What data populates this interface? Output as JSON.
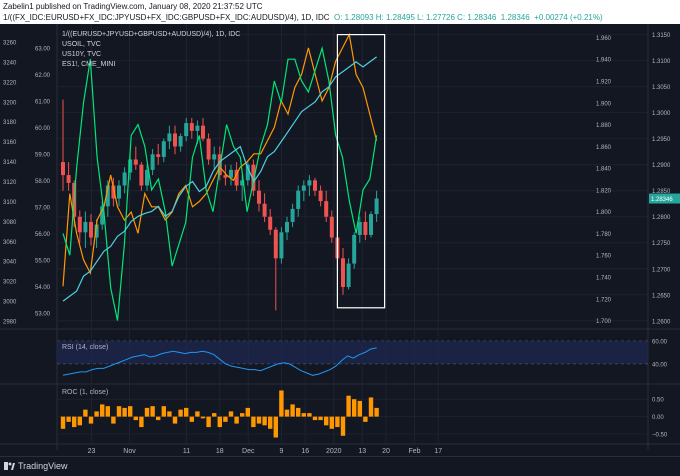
{
  "header": {
    "publisher": "Zabelin1 published on TradingView.com, January 08, 2020 21:37:52 UTC",
    "symbol_line": "1/((FX_IDC:EURUSD+FX_IDC:JPYUSD+FX_IDC:GBPUSD+FX_IDC:AUDUSD)/4), 1D, IDC",
    "ohlc": "O: 1.28093 H: 1.28495 L: 1.27726 C: 1.28346",
    "last": "1.28346",
    "change": "+0.00274 (+0.21%)"
  },
  "legend": {
    "main": "1/((EURUSD+JPYUSD+GBPUSD+AUDUSD)/4), 1D, IDC",
    "s1": "USOIL, TVC",
    "s2": "US10Y, TVC",
    "s3": "ES1!, CME_MINI"
  },
  "footer": {
    "brand": "TradingView"
  },
  "colors": {
    "bg": "#131722",
    "grid": "#1e2230",
    "up": "#26a69a",
    "down": "#ef5350",
    "usoil": "#ff9800",
    "us10y": "#00e676",
    "es": "#4dd0e1",
    "roc": "#ff9800",
    "rsi": "#2196f3"
  },
  "chart_data": [
    {
      "type": "line",
      "name": "main",
      "x_tick_labels": [
        "23",
        "Nov",
        "11",
        "18",
        "Dec",
        "9",
        "16",
        "2020",
        "13",
        "20",
        "Feb",
        "17"
      ],
      "left_axis": {
        "ticks": [
          2980,
          3000,
          3020,
          3040,
          3060,
          3080,
          3100,
          3120,
          3140,
          3160,
          3180,
          3200,
          3220,
          3240,
          3260
        ]
      },
      "inner_axis": {
        "ticks": [
          53.0,
          54.0,
          55.0,
          56.0,
          57.0,
          58.0,
          59.0,
          60.0,
          61.0,
          62.0,
          63.0
        ]
      },
      "right_axis": {
        "ticks": [
          1.26,
          1.265,
          1.27,
          1.275,
          1.28,
          1.285,
          1.29,
          1.295,
          1.3,
          1.305,
          1.31,
          1.315
        ],
        "ticks_labels": [
          "1.2600",
          "1.2650",
          "1.2700",
          "1.2750",
          "1.2800",
          "1.2850",
          "1.2900",
          "1.2950",
          "1.3000",
          "1.3050",
          "1.3100",
          "1.3150"
        ],
        "ticks2": [
          1.7,
          1.72,
          1.74,
          1.76,
          1.78,
          1.8,
          1.82,
          1.84,
          1.86,
          1.88,
          1.9,
          1.92,
          1.94,
          1.96
        ],
        "ticks2_labels": [
          "1.700",
          "1.720",
          "1.740",
          "1.760",
          "1.780",
          "1.800",
          "1.820",
          "1.840",
          "1.860",
          "1.880",
          "1.900",
          "1.920",
          "1.940",
          "1.960"
        ],
        "last_label": "1.28346"
      },
      "candles": [
        [
          1.2905,
          1.3025,
          1.285,
          1.288
        ],
        [
          1.288,
          1.2905,
          1.285,
          1.2865
        ],
        [
          1.2865,
          1.287,
          1.278,
          1.28
        ],
        [
          1.28,
          1.2812,
          1.275,
          1.277
        ],
        [
          1.277,
          1.281,
          1.274,
          1.279
        ],
        [
          1.279,
          1.2805,
          1.2745,
          1.276
        ],
        [
          1.276,
          1.2795,
          1.274,
          1.2785
        ],
        [
          1.2785,
          1.283,
          1.2775,
          1.282
        ],
        [
          1.282,
          1.287,
          1.28,
          1.286
        ],
        [
          1.286,
          1.2875,
          1.282,
          1.2835
        ],
        [
          1.2835,
          1.287,
          1.282,
          1.286
        ],
        [
          1.286,
          1.2895,
          1.2845,
          1.2885
        ],
        [
          1.2885,
          1.292,
          1.287,
          1.291
        ],
        [
          1.291,
          1.2935,
          1.289,
          1.29
        ],
        [
          1.29,
          1.2905,
          1.285,
          1.286
        ],
        [
          1.286,
          1.29,
          1.285,
          1.289
        ],
        [
          1.289,
          1.293,
          1.288,
          1.292
        ],
        [
          1.292,
          1.294,
          1.29,
          1.2915
        ],
        [
          1.2915,
          1.295,
          1.2905,
          1.2945
        ],
        [
          1.2945,
          1.2975,
          1.293,
          1.296
        ],
        [
          1.296,
          1.2975,
          1.292,
          1.2935
        ],
        [
          1.2935,
          1.296,
          1.2925,
          1.2955
        ],
        [
          1.2955,
          1.299,
          1.2945,
          1.298
        ],
        [
          1.298,
          1.299,
          1.295,
          1.2965
        ],
        [
          1.2965,
          1.2985,
          1.294,
          1.2975
        ],
        [
          1.2975,
          1.299,
          1.2945,
          1.295
        ],
        [
          1.295,
          1.296,
          1.29,
          1.291
        ],
        [
          1.291,
          1.2935,
          1.289,
          1.292
        ],
        [
          1.292,
          1.2935,
          1.287,
          1.288
        ],
        [
          1.288,
          1.29,
          1.286,
          1.2875
        ],
        [
          1.2875,
          1.29,
          1.286,
          1.289
        ],
        [
          1.289,
          1.2905,
          1.285,
          1.286
        ],
        [
          1.286,
          1.288,
          1.283,
          1.287
        ],
        [
          1.287,
          1.2905,
          1.286,
          1.29
        ],
        [
          1.29,
          1.291,
          1.284,
          1.285
        ],
        [
          1.285,
          1.287,
          1.281,
          1.2825
        ],
        [
          1.2825,
          1.2845,
          1.279,
          1.28
        ],
        [
          1.28,
          1.2815,
          1.2765,
          1.2775
        ],
        [
          1.2775,
          1.278,
          1.262,
          1.272
        ],
        [
          1.272,
          1.278,
          1.271,
          1.277
        ],
        [
          1.277,
          1.28,
          1.2755,
          1.279
        ],
        [
          1.279,
          1.2825,
          1.278,
          1.2815
        ],
        [
          1.2815,
          1.286,
          1.28,
          1.285
        ],
        [
          1.285,
          1.287,
          1.283,
          1.286
        ],
        [
          1.286,
          1.288,
          1.284,
          1.287
        ],
        [
          1.287,
          1.2875,
          1.284,
          1.285
        ],
        [
          1.285,
          1.286,
          1.282,
          1.283
        ],
        [
          1.283,
          1.285,
          1.279,
          1.28
        ],
        [
          1.28,
          1.2812,
          1.275,
          1.276
        ],
        [
          1.276,
          1.2775,
          1.27,
          1.272
        ],
        [
          1.272,
          1.274,
          1.265,
          1.2665
        ],
        [
          1.2665,
          1.272,
          1.266,
          1.271
        ],
        [
          1.271,
          1.277,
          1.27,
          1.2765
        ],
        [
          1.2765,
          1.28,
          1.275,
          1.279
        ],
        [
          1.279,
          1.281,
          1.2755,
          1.2765
        ],
        [
          1.2765,
          1.281,
          1.276,
          1.2805
        ],
        [
          1.2805,
          1.285,
          1.279,
          1.2835
        ]
      ],
      "usoil": [
        54.0,
        57.5,
        56.0,
        55.0,
        54.5,
        56.5,
        57.0,
        58.2,
        57.0,
        56.5,
        56.8,
        56.0,
        57.5,
        57.0,
        57.0,
        56.5,
        56.8,
        57.5,
        57.8,
        57.0,
        57.2,
        57.5,
        58.0,
        58.5,
        58.2,
        58.0,
        58.5,
        58.7,
        59.0,
        59.0,
        59.5,
        60.0,
        61.0,
        60.5,
        61.5,
        62.0,
        63.0,
        62.0,
        61.0,
        61.5,
        62.5,
        63.0,
        63.5,
        62.0,
        61.5,
        60.5,
        59.5
      ],
      "us10y": [
        1.78,
        1.76,
        1.84,
        1.9,
        1.94,
        1.85,
        1.8,
        1.73,
        1.7,
        1.77,
        1.87,
        1.88,
        1.86,
        1.82,
        1.83,
        1.8,
        1.75,
        1.77,
        1.79,
        1.85,
        1.87,
        1.82,
        1.8,
        1.84,
        1.88,
        1.86,
        1.85,
        1.8,
        1.83,
        1.86,
        1.88,
        1.92,
        1.9,
        1.94,
        1.94,
        1.92,
        1.91,
        1.93,
        1.95,
        1.92,
        1.87,
        1.85,
        1.81,
        1.78,
        1.82,
        1.83,
        1.87
      ],
      "es": [
        3000,
        3005,
        3010,
        3025,
        3030,
        3040,
        3050,
        3055,
        3065,
        3070,
        3080,
        3085,
        3088,
        3090,
        3095,
        3085,
        3090,
        3105,
        3115,
        3120,
        3110,
        3115,
        3130,
        3140,
        3145,
        3150,
        3155,
        3135,
        3120,
        3130,
        3145,
        3150,
        3160,
        3170,
        3180,
        3190,
        3195,
        3200,
        3210,
        3215,
        3225,
        3230,
        3235,
        3240,
        3235,
        3240,
        3245
      ]
    },
    {
      "type": "line",
      "name": "RSI (14, close)",
      "title": "RSI (14, close)",
      "ticks": [
        40.0,
        60.0
      ],
      "ticks_labels": [
        "40.00",
        "60.00"
      ],
      "values": [
        30,
        31,
        32,
        33,
        33,
        35,
        36,
        36,
        38,
        40,
        42,
        44,
        46,
        47,
        48,
        46,
        47,
        49,
        50,
        51,
        50,
        49,
        50,
        50,
        51,
        50,
        48,
        44,
        40,
        38,
        37,
        36,
        35,
        35,
        34,
        36,
        38,
        40,
        41,
        40,
        37,
        34,
        32,
        30,
        31,
        33,
        35,
        38,
        43,
        47,
        45,
        48,
        50,
        53,
        54
      ]
    },
    {
      "type": "bar",
      "name": "ROC (1, close)",
      "title": "ROC (1, close)",
      "ticks": [
        -0.5,
        0.0,
        0.5
      ],
      "ticks_labels": [
        "−0.50",
        "0.00",
        "0.50"
      ],
      "values": [
        -0.35,
        -0.15,
        -0.3,
        -0.25,
        0.2,
        -0.2,
        0.15,
        0.35,
        0.3,
        -0.2,
        0.3,
        0.25,
        0.3,
        -0.1,
        -0.3,
        0.25,
        0.3,
        -0.1,
        0.3,
        0.15,
        -0.2,
        0.2,
        0.25,
        -0.15,
        0.15,
        -0.05,
        -0.3,
        0.1,
        -0.3,
        -0.15,
        0.15,
        -0.2,
        0.1,
        0.25,
        -0.3,
        -0.2,
        -0.25,
        -0.35,
        -0.6,
        0.75,
        0.2,
        0.35,
        0.25,
        0.1,
        0.1,
        -0.1,
        -0.1,
        -0.25,
        -0.35,
        -0.3,
        -0.55,
        0.6,
        0.5,
        0.45,
        -0.15,
        0.55,
        0.25
      ]
    }
  ]
}
